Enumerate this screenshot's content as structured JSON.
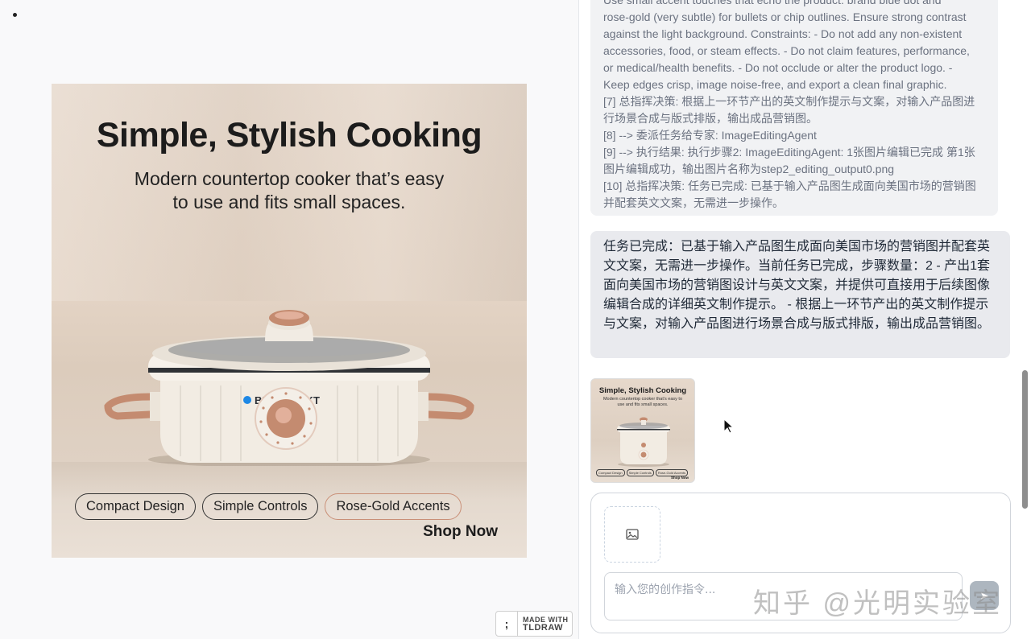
{
  "poster": {
    "title": "Simple, Stylish Cooking",
    "subtitle_line1": "Modern countertop cooker that’s easy",
    "subtitle_line2": "to use and fits small spaces.",
    "brand": "BLAUPUNKT",
    "chips": [
      "Compact Design",
      "Simple Controls",
      "Rose-Gold Accents"
    ],
    "cta": "Shop Now"
  },
  "tldraw_badge": {
    "line1": "MADE WITH",
    "line2": "TLDRAW"
  },
  "chat": {
    "log_lines": [
      "Use small accent touches that echo the product: brand blue dot and",
      "rose-gold (very subtle) for bullets or chip outlines. Ensure strong contrast",
      "against the light background. Constraints: - Do not add any non-existent",
      "accessories, food, or steam effects. - Do not claim features, performance,",
      "or medical/health benefits. - Do not occlude or alter the product logo. -",
      "Keep edges crisp, image noise-free, and export a clean final graphic.",
      "[7] 总指挥决策: 根据上一环节产出的英文制作提示与文案，对输入产品图进",
      "行场景合成与版式排版，输出成品营销图。",
      "[8] --> 委派任务给专家: ImageEditingAgent",
      "[9] --> 执行结果: 执行步骤2: ImageEditingAgent: 1张图片编辑已完成 第1张",
      "图片编辑成功，输出图片名称为step2_editing_output0.png",
      "[10] 总指挥决策: 任务已完成: 已基于输入产品图生成面向美国市场的营销图",
      "并配套英文文案，无需进一步操作。"
    ],
    "message": "任务已完成：已基于输入产品图生成面向美国市场的营销图并配套英文文案，无需进一步操作。当前任务已完成，步骤数量：2 - 产出1套面向美国市场的营销图设计与英文文案，并提供可直接用于后续图像编辑合成的详细英文制作提示。 - 根据上一环节产出的英文制作提示与文案，对输入产品图进行场景合成与版式排版，输出成品营销图。",
    "thumbnail": {
      "title": "Simple, Stylish Cooking",
      "subtitle": "Modern countertop cooker that’s easy to use and fits small spaces.",
      "chips": [
        "Compact Design",
        "Simple Controls",
        "Rose-Gold Accents"
      ],
      "cta": "Shop Now"
    },
    "composer": {
      "upload_icon": "image-icon",
      "placeholder": "输入您的创作指令...",
      "send_icon": "send-icon"
    }
  },
  "watermark": "知乎 @光明实验室",
  "colors": {
    "brand_blue": "#1e88e5",
    "rose_gold": "#c98f77",
    "cooker_body": "#f2ece3"
  }
}
